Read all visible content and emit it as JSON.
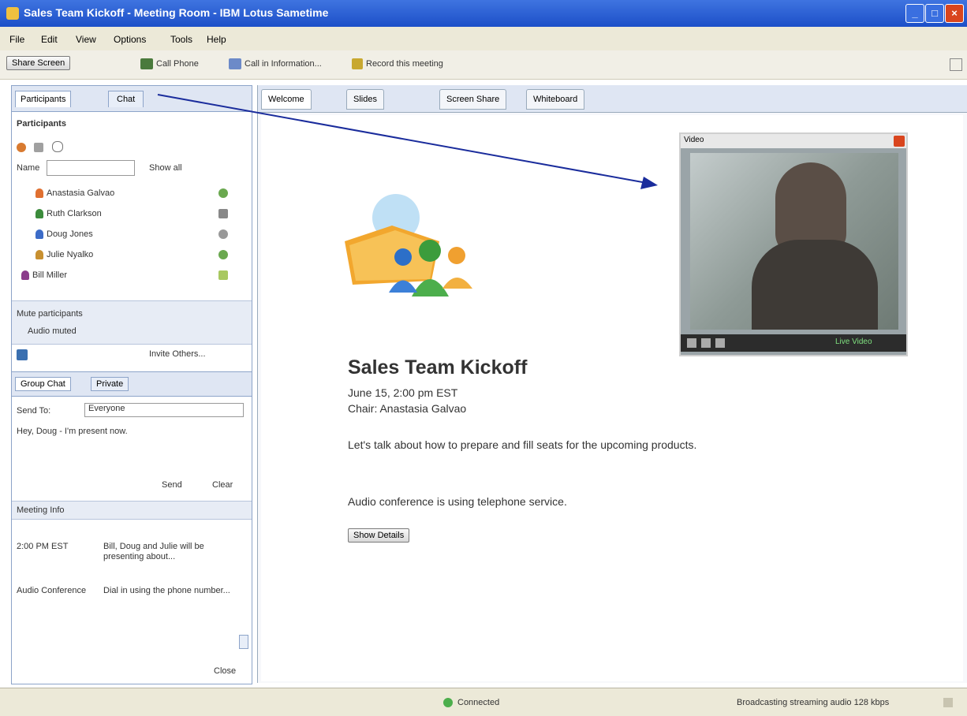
{
  "window": {
    "title": "Sales Team Kickoff - Meeting Room - IBM Lotus Sametime"
  },
  "menu": [
    "File",
    "Edit",
    "View",
    "Options",
    "Tools",
    "Help"
  ],
  "toolbar": {
    "share_label": "Share Screen",
    "call_label": "Call Phone",
    "call_in_label": "Call in Information...",
    "record_label": "Record this meeting"
  },
  "left_tabs": [
    "Participants",
    "Chat"
  ],
  "participants": {
    "header": "Participants",
    "sort_label": "Name",
    "view_label": "Show all",
    "list": [
      {
        "name": "Anastasia Galvao",
        "color": "#e07030"
      },
      {
        "name": "Ruth Clarkson",
        "color": "#3c8c3c"
      },
      {
        "name": "Doug Jones",
        "color": "#3c6cc8"
      },
      {
        "name": "Julie Nyalko",
        "color": "#c89030"
      },
      {
        "name": "Bill Miller",
        "color": "#8c3c8c"
      }
    ],
    "mute_label": "Mute participants",
    "mute_value": "Audio muted",
    "invite_label": "Invite Others..."
  },
  "chat": {
    "tabs": [
      "Group Chat",
      "Private"
    ],
    "to_label": "Send To:",
    "to_value": "Everyone",
    "message": "Hey, Doug - I'm present now.",
    "send_label": "Send",
    "clear_label": "Clear"
  },
  "meeting_info": {
    "header": "Meeting Info",
    "rows": [
      {
        "label": "2:00 PM EST",
        "value": "Bill, Doug and Julie will be presenting about..."
      },
      {
        "label": "Audio Conference",
        "value": "Dial in using the phone number..."
      }
    ],
    "close_label": "Close"
  },
  "main_tabs": [
    "Welcome",
    "Slides",
    "Screen Share",
    "Whiteboard"
  ],
  "meeting": {
    "title": "Sales Team Kickoff",
    "date": "June 15, 2:00 pm EST",
    "chair": "Chair: Anastasia Galvao",
    "description": "Let's talk about how to prepare and fill seats for the upcoming products.",
    "audio_text": "Audio conference is using telephone service.",
    "join_button": "Show Details"
  },
  "video": {
    "title": "Video",
    "status": "Live Video"
  },
  "status": {
    "left": "Connected",
    "right": "Broadcasting streaming audio 128 kbps"
  },
  "colors": {
    "accent": "#3f74e0",
    "arrow": "#1a2c9c",
    "panel_border": "#8da4c9"
  }
}
